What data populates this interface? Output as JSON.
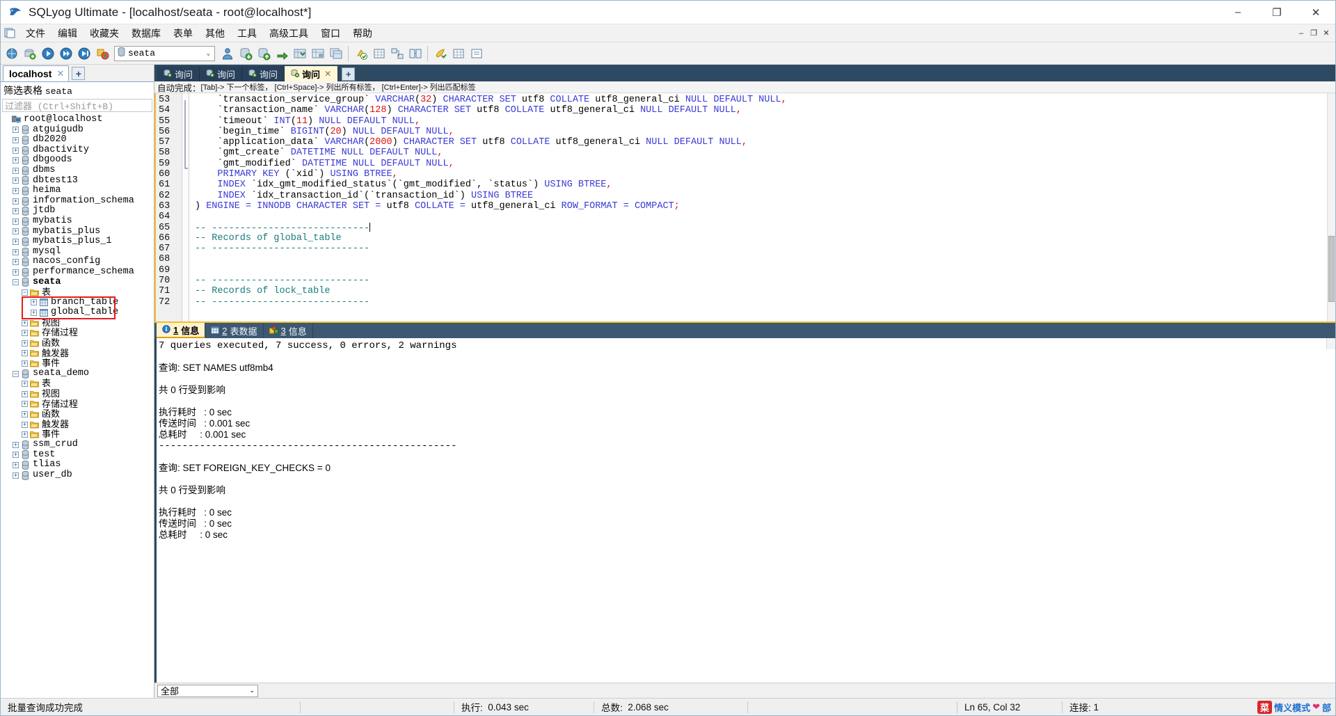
{
  "window": {
    "title": "SQLyog Ultimate - [localhost/seata - root@localhost*]",
    "app_icon": "sqlyog-dolphin-icon",
    "minimize": "–",
    "maximize": "❐",
    "close": "✕"
  },
  "menu": {
    "mdi_icon": "mdi-document-icon",
    "items": [
      {
        "label": "文件"
      },
      {
        "label": "编辑"
      },
      {
        "label": "收藏夹"
      },
      {
        "label": "数据库"
      },
      {
        "label": "表单"
      },
      {
        "label": "其他"
      },
      {
        "label": "工具"
      },
      {
        "label": "高级工具"
      },
      {
        "label": "窗口"
      },
      {
        "label": "帮助"
      }
    ],
    "mdi_buttons": [
      {
        "name": "mdi-minimize",
        "glyph": "–"
      },
      {
        "name": "mdi-restore",
        "glyph": "❐"
      },
      {
        "name": "mdi-close",
        "glyph": "✕"
      }
    ]
  },
  "toolbar": {
    "db_selector_value": "seata",
    "db_selector_icon": "database-icon",
    "chevron": "⌄",
    "buttons": [
      {
        "name": "new-connection-icon"
      },
      {
        "name": "new-query-icon"
      },
      {
        "name": "execute-query-icon"
      },
      {
        "name": "execute-all-queries-icon"
      },
      {
        "name": "execute-current-icon"
      },
      {
        "name": "stop-query-icon"
      },
      {
        "name": "user-manager-icon"
      },
      {
        "name": "import-data-icon"
      },
      {
        "name": "export-data-icon"
      },
      {
        "name": "sync-data-icon"
      },
      {
        "name": "backup-database-icon"
      },
      {
        "name": "restore-database-icon"
      },
      {
        "name": "copy-database-icon"
      },
      {
        "name": "refresh-objects-icon"
      },
      {
        "name": "table-diagnostics-icon"
      },
      {
        "name": "schema-designer-icon"
      },
      {
        "name": "query-builder-icon"
      },
      {
        "name": "data-search-icon"
      },
      {
        "name": "grid-view-icon"
      },
      {
        "name": "form-view-icon"
      }
    ]
  },
  "left_pane": {
    "connection_tab": {
      "label": "localhost",
      "close_glyph": "✕"
    },
    "add_tab_glyph": "+",
    "filter_label_prefix": "筛选表格",
    "filter_label_db": "seata",
    "filter_placeholder": "过滤器 (Ctrl+Shift+B)",
    "tree": [
      {
        "label": "root@localhost",
        "depth": 0,
        "exp": "",
        "icon": "server-icon",
        "bold": false,
        "cjk": false
      },
      {
        "label": "atguigudb",
        "depth": 1,
        "exp": "+",
        "icon": "database-icon",
        "bold": false,
        "cjk": false
      },
      {
        "label": "db2020",
        "depth": 1,
        "exp": "+",
        "icon": "database-icon",
        "bold": false,
        "cjk": false
      },
      {
        "label": "dbactivity",
        "depth": 1,
        "exp": "+",
        "icon": "database-icon",
        "bold": false,
        "cjk": false
      },
      {
        "label": "dbgoods",
        "depth": 1,
        "exp": "+",
        "icon": "database-icon",
        "bold": false,
        "cjk": false
      },
      {
        "label": "dbms",
        "depth": 1,
        "exp": "+",
        "icon": "database-icon",
        "bold": false,
        "cjk": false
      },
      {
        "label": "dbtest13",
        "depth": 1,
        "exp": "+",
        "icon": "database-icon",
        "bold": false,
        "cjk": false
      },
      {
        "label": "heima",
        "depth": 1,
        "exp": "+",
        "icon": "database-icon",
        "bold": false,
        "cjk": false
      },
      {
        "label": "information_schema",
        "depth": 1,
        "exp": "+",
        "icon": "database-icon",
        "bold": false,
        "cjk": false
      },
      {
        "label": "jtdb",
        "depth": 1,
        "exp": "+",
        "icon": "database-icon",
        "bold": false,
        "cjk": false
      },
      {
        "label": "mybatis",
        "depth": 1,
        "exp": "+",
        "icon": "database-icon",
        "bold": false,
        "cjk": false
      },
      {
        "label": "mybatis_plus",
        "depth": 1,
        "exp": "+",
        "icon": "database-icon",
        "bold": false,
        "cjk": false
      },
      {
        "label": "mybatis_plus_1",
        "depth": 1,
        "exp": "+",
        "icon": "database-icon",
        "bold": false,
        "cjk": false
      },
      {
        "label": "mysql",
        "depth": 1,
        "exp": "+",
        "icon": "database-icon",
        "bold": false,
        "cjk": false
      },
      {
        "label": "nacos_config",
        "depth": 1,
        "exp": "+",
        "icon": "database-icon",
        "bold": false,
        "cjk": false
      },
      {
        "label": "performance_schema",
        "depth": 1,
        "exp": "+",
        "icon": "database-icon",
        "bold": false,
        "cjk": false
      },
      {
        "label": "seata",
        "depth": 1,
        "exp": "−",
        "icon": "database-icon",
        "bold": true,
        "cjk": false
      },
      {
        "label": "表",
        "depth": 2,
        "exp": "−",
        "icon": "folder-icon",
        "bold": false,
        "cjk": true
      },
      {
        "label": "branch_table",
        "depth": 3,
        "exp": "+",
        "icon": "table-icon",
        "bold": false,
        "cjk": false
      },
      {
        "label": "global_table",
        "depth": 3,
        "exp": "+",
        "icon": "table-icon",
        "bold": false,
        "cjk": false
      },
      {
        "label": "视图",
        "depth": 2,
        "exp": "+",
        "icon": "folder-icon",
        "bold": false,
        "cjk": true
      },
      {
        "label": "存储过程",
        "depth": 2,
        "exp": "+",
        "icon": "folder-icon",
        "bold": false,
        "cjk": true
      },
      {
        "label": "函数",
        "depth": 2,
        "exp": "+",
        "icon": "folder-icon",
        "bold": false,
        "cjk": true
      },
      {
        "label": "触发器",
        "depth": 2,
        "exp": "+",
        "icon": "folder-icon",
        "bold": false,
        "cjk": true
      },
      {
        "label": "事件",
        "depth": 2,
        "exp": "+",
        "icon": "folder-icon",
        "bold": false,
        "cjk": true
      },
      {
        "label": "seata_demo",
        "depth": 1,
        "exp": "−",
        "icon": "database-icon",
        "bold": false,
        "cjk": false
      },
      {
        "label": "表",
        "depth": 2,
        "exp": "+",
        "icon": "folder-icon",
        "bold": false,
        "cjk": true
      },
      {
        "label": "视图",
        "depth": 2,
        "exp": "+",
        "icon": "folder-icon",
        "bold": false,
        "cjk": true
      },
      {
        "label": "存储过程",
        "depth": 2,
        "exp": "+",
        "icon": "folder-icon",
        "bold": false,
        "cjk": true
      },
      {
        "label": "函数",
        "depth": 2,
        "exp": "+",
        "icon": "folder-icon",
        "bold": false,
        "cjk": true
      },
      {
        "label": "触发器",
        "depth": 2,
        "exp": "+",
        "icon": "folder-icon",
        "bold": false,
        "cjk": true
      },
      {
        "label": "事件",
        "depth": 2,
        "exp": "+",
        "icon": "folder-icon",
        "bold": false,
        "cjk": true
      },
      {
        "label": "ssm_crud",
        "depth": 1,
        "exp": "+",
        "icon": "database-icon",
        "bold": false,
        "cjk": false
      },
      {
        "label": "test",
        "depth": 1,
        "exp": "+",
        "icon": "database-icon",
        "bold": false,
        "cjk": false
      },
      {
        "label": "tlias",
        "depth": 1,
        "exp": "+",
        "icon": "database-icon",
        "bold": false,
        "cjk": false
      },
      {
        "label": "user_db",
        "depth": 1,
        "exp": "+",
        "icon": "database-icon",
        "bold": false,
        "cjk": false
      }
    ],
    "highlight_box": {
      "color": "#e8191a",
      "covers": "branch_table and global_table rows"
    }
  },
  "query_tabs": {
    "tabs": [
      {
        "label": "询问",
        "active": false,
        "icon": "query-icon"
      },
      {
        "label": "询问",
        "active": false,
        "icon": "query-icon"
      },
      {
        "label": "询问",
        "active": false,
        "icon": "query-icon"
      },
      {
        "label": "询问",
        "active": true,
        "icon": "query-icon",
        "close_glyph": "✕"
      }
    ],
    "add_glyph": "+"
  },
  "editor": {
    "autocomplete_hint_prefix": "自动完成：",
    "autocomplete_hint": "[Tab]-> 下一个标签， [Ctrl+Space]-> 列出所有标签， [Ctrl+Enter]-> 列出匹配标签",
    "first_line_number": 53,
    "lines": [
      {
        "n": 53,
        "segments": [
          {
            "t": "    `transaction_service_group` ",
            "c": "ident"
          },
          {
            "t": "VARCHAR",
            "c": "kw"
          },
          {
            "t": "(",
            "c": "ident"
          },
          {
            "t": "32",
            "c": "num"
          },
          {
            "t": ") ",
            "c": "ident"
          },
          {
            "t": "CHARACTER SET ",
            "c": "kw"
          },
          {
            "t": "utf8 ",
            "c": "ident"
          },
          {
            "t": "COLLATE ",
            "c": "kw"
          },
          {
            "t": "utf8_general_ci ",
            "c": "ident"
          },
          {
            "t": "NULL DEFAULT NULL",
            "c": "kw"
          },
          {
            "t": ",",
            "c": "num"
          }
        ]
      },
      {
        "n": 54,
        "segments": [
          {
            "t": "    `transaction_name` ",
            "c": "ident"
          },
          {
            "t": "VARCHAR",
            "c": "kw"
          },
          {
            "t": "(",
            "c": "ident"
          },
          {
            "t": "128",
            "c": "num"
          },
          {
            "t": ") ",
            "c": "ident"
          },
          {
            "t": "CHARACTER SET ",
            "c": "kw"
          },
          {
            "t": "utf8 ",
            "c": "ident"
          },
          {
            "t": "COLLATE ",
            "c": "kw"
          },
          {
            "t": "utf8_general_ci ",
            "c": "ident"
          },
          {
            "t": "NULL DEFAULT NULL",
            "c": "kw"
          },
          {
            "t": ",",
            "c": "num"
          }
        ]
      },
      {
        "n": 55,
        "segments": [
          {
            "t": "    `timeout` ",
            "c": "ident"
          },
          {
            "t": "INT",
            "c": "kw"
          },
          {
            "t": "(",
            "c": "ident"
          },
          {
            "t": "11",
            "c": "num"
          },
          {
            "t": ") ",
            "c": "ident"
          },
          {
            "t": "NULL DEFAULT NULL",
            "c": "kw"
          },
          {
            "t": ",",
            "c": "num"
          }
        ]
      },
      {
        "n": 56,
        "segments": [
          {
            "t": "    `begin_time` ",
            "c": "ident"
          },
          {
            "t": "BIGINT",
            "c": "kw"
          },
          {
            "t": "(",
            "c": "ident"
          },
          {
            "t": "20",
            "c": "num"
          },
          {
            "t": ") ",
            "c": "ident"
          },
          {
            "t": "NULL DEFAULT NULL",
            "c": "kw"
          },
          {
            "t": ",",
            "c": "num"
          }
        ]
      },
      {
        "n": 57,
        "segments": [
          {
            "t": "    `application_data` ",
            "c": "ident"
          },
          {
            "t": "VARCHAR",
            "c": "kw"
          },
          {
            "t": "(",
            "c": "ident"
          },
          {
            "t": "2000",
            "c": "num"
          },
          {
            "t": ") ",
            "c": "ident"
          },
          {
            "t": "CHARACTER SET ",
            "c": "kw"
          },
          {
            "t": "utf8 ",
            "c": "ident"
          },
          {
            "t": "COLLATE ",
            "c": "kw"
          },
          {
            "t": "utf8_general_ci ",
            "c": "ident"
          },
          {
            "t": "NULL DEFAULT NULL",
            "c": "kw"
          },
          {
            "t": ",",
            "c": "num"
          }
        ]
      },
      {
        "n": 58,
        "segments": [
          {
            "t": "    `gmt_create` ",
            "c": "ident"
          },
          {
            "t": "DATETIME NULL DEFAULT NULL",
            "c": "kw"
          },
          {
            "t": ",",
            "c": "num"
          }
        ]
      },
      {
        "n": 59,
        "segments": [
          {
            "t": "    `gmt_modified` ",
            "c": "ident"
          },
          {
            "t": "DATETIME NULL DEFAULT NULL",
            "c": "kw"
          },
          {
            "t": ",",
            "c": "num"
          }
        ]
      },
      {
        "n": 60,
        "segments": [
          {
            "t": "    ",
            "c": "ident"
          },
          {
            "t": "PRIMARY KEY ",
            "c": "kw"
          },
          {
            "t": "(`xid`) ",
            "c": "ident"
          },
          {
            "t": "USING BTREE",
            "c": "kw"
          },
          {
            "t": ",",
            "c": "num"
          }
        ]
      },
      {
        "n": 61,
        "segments": [
          {
            "t": "    ",
            "c": "ident"
          },
          {
            "t": "INDEX ",
            "c": "kw"
          },
          {
            "t": "`idx_gmt_modified_status`(`gmt_modified`, `status`) ",
            "c": "ident"
          },
          {
            "t": "USING BTREE",
            "c": "kw"
          },
          {
            "t": ",",
            "c": "num"
          }
        ]
      },
      {
        "n": 62,
        "segments": [
          {
            "t": "    ",
            "c": "ident"
          },
          {
            "t": "INDEX ",
            "c": "kw"
          },
          {
            "t": "`idx_transaction_id`(`transaction_id`) ",
            "c": "ident"
          },
          {
            "t": "USING BTREE",
            "c": "kw"
          }
        ]
      },
      {
        "n": 63,
        "segments": [
          {
            "t": ") ",
            "c": "ident"
          },
          {
            "t": "ENGINE = ",
            "c": "kw"
          },
          {
            "t": "INNODB ",
            "c": "kw"
          },
          {
            "t": "CHARACTER SET = ",
            "c": "kw"
          },
          {
            "t": "utf8 ",
            "c": "ident"
          },
          {
            "t": "COLLATE = ",
            "c": "kw"
          },
          {
            "t": "utf8_general_ci ",
            "c": "ident"
          },
          {
            "t": "ROW_FORMAT = ",
            "c": "kw"
          },
          {
            "t": "COMPACT",
            "c": "kw"
          },
          {
            "t": ";",
            "c": "num"
          }
        ]
      },
      {
        "n": 64,
        "segments": []
      },
      {
        "n": 65,
        "segments": [
          {
            "t": "-- ----------------------------",
            "c": "cmt"
          }
        ],
        "caret_at_end": true
      },
      {
        "n": 66,
        "segments": [
          {
            "t": "-- Records of global_table",
            "c": "cmt"
          }
        ]
      },
      {
        "n": 67,
        "segments": [
          {
            "t": "-- ----------------------------",
            "c": "cmt"
          }
        ]
      },
      {
        "n": 68,
        "segments": []
      },
      {
        "n": 69,
        "segments": []
      },
      {
        "n": 70,
        "segments": [
          {
            "t": "-- ----------------------------",
            "c": "cmt"
          }
        ]
      },
      {
        "n": 71,
        "segments": [
          {
            "t": "-- Records of lock_table",
            "c": "cmt"
          }
        ]
      },
      {
        "n": 72,
        "segments": [
          {
            "t": "-- ----------------------------",
            "c": "cmt"
          }
        ]
      }
    ]
  },
  "results": {
    "tabs": [
      {
        "num": "1",
        "label": "信息",
        "icon": "info-icon",
        "active": true
      },
      {
        "num": "2",
        "label": "表数据",
        "icon": "grid-icon",
        "active": false
      },
      {
        "num": "3",
        "label": "信息",
        "icon": "objects-icon",
        "active": false
      }
    ],
    "message_lines": [
      {
        "text": "7 queries executed, 7 success, 0 errors, 2 warnings",
        "cjk": false
      },
      {
        "text": "",
        "cjk": false
      },
      {
        "text": "查询: SET NAMES utf8mb4",
        "cjk": true
      },
      {
        "text": "",
        "cjk": false
      },
      {
        "text": "共 0 行受到影响",
        "cjk": true
      },
      {
        "text": "",
        "cjk": false
      },
      {
        "text": "执行耗时   : 0 sec",
        "cjk": true
      },
      {
        "text": "传送时间   : 0.001 sec",
        "cjk": true
      },
      {
        "text": "总耗时     : 0.001 sec",
        "cjk": true
      },
      {
        "text": "---------------------------------------------------",
        "cjk": false
      },
      {
        "text": "",
        "cjk": false
      },
      {
        "text": "查询: SET FOREIGN_KEY_CHECKS = 0",
        "cjk": true
      },
      {
        "text": "",
        "cjk": false
      },
      {
        "text": "共 0 行受到影响",
        "cjk": true
      },
      {
        "text": "",
        "cjk": false
      },
      {
        "text": "执行耗时   : 0 sec",
        "cjk": true
      },
      {
        "text": "传送时间   : 0 sec",
        "cjk": true
      },
      {
        "text": "总耗时     : 0 sec",
        "cjk": true
      }
    ],
    "bottom_selector_value": "全部",
    "bottom_selector_chevron": "⌄"
  },
  "status_bar": {
    "message": "批量查询成功完成",
    "exec_label": "执行:",
    "exec_value": "0.043 sec",
    "total_label": "总数:",
    "total_value": "2.068 sec",
    "cursor_position": "Ln 65, Col 32",
    "connection_label": "连接:",
    "connection_value": "1",
    "watermark": {
      "badge": "菜",
      "text1": "情义模式",
      "text2": "部",
      "heart": "❤"
    }
  }
}
